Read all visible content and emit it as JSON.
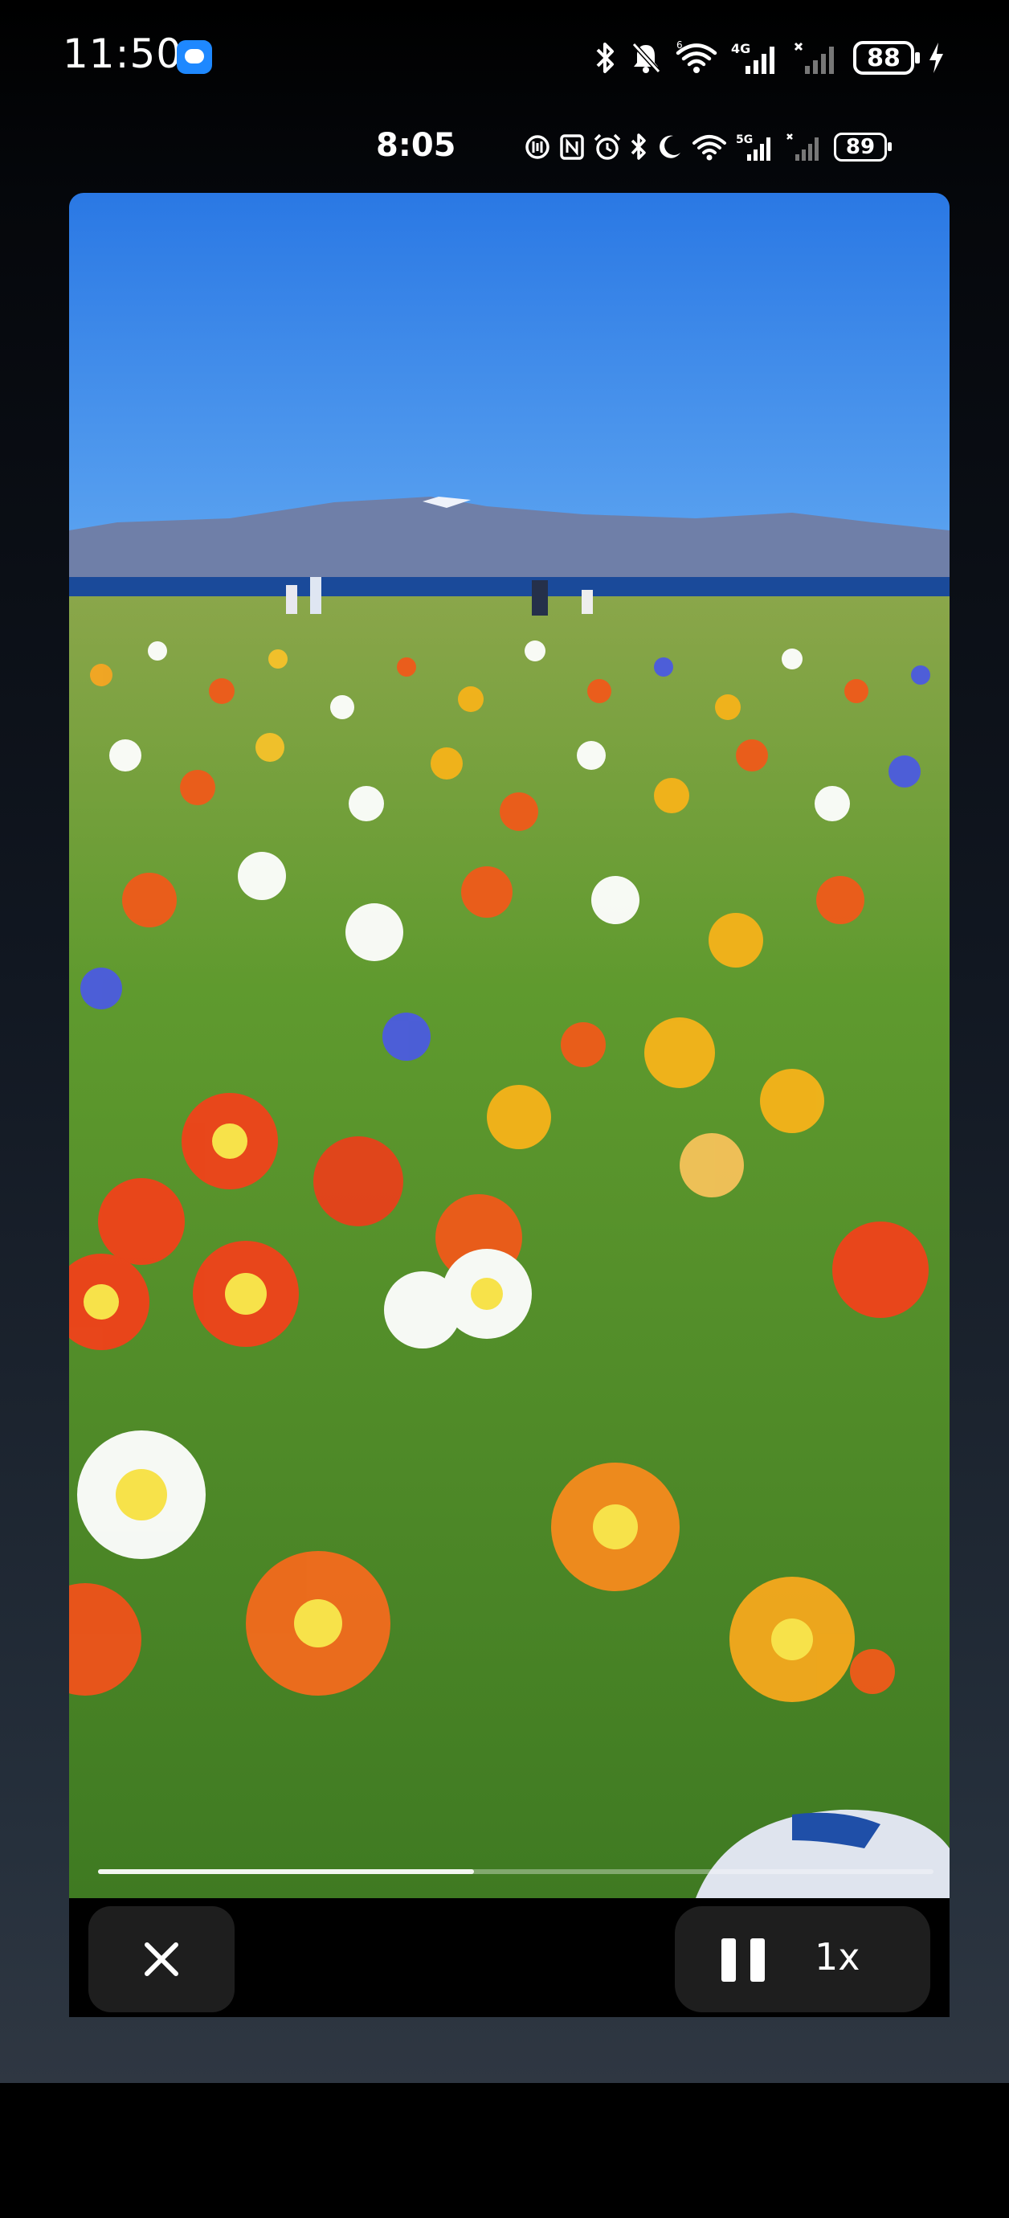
{
  "outer_status": {
    "time": "11:50",
    "network_label": "4G",
    "battery": "88"
  },
  "inner_status": {
    "time": "8:05",
    "network_label": "5G",
    "battery": "89"
  },
  "video": {
    "scene_icon": "poppy-field-video-frame",
    "progress_fraction": 0.45
  },
  "controls": {
    "speed_label": "1x"
  },
  "colors": {
    "sky": "#2f7ee6",
    "poppy_orange": "#f05a1a",
    "poppy_yellow": "#f6b31a",
    "button_bg": "#1e1e1e"
  }
}
